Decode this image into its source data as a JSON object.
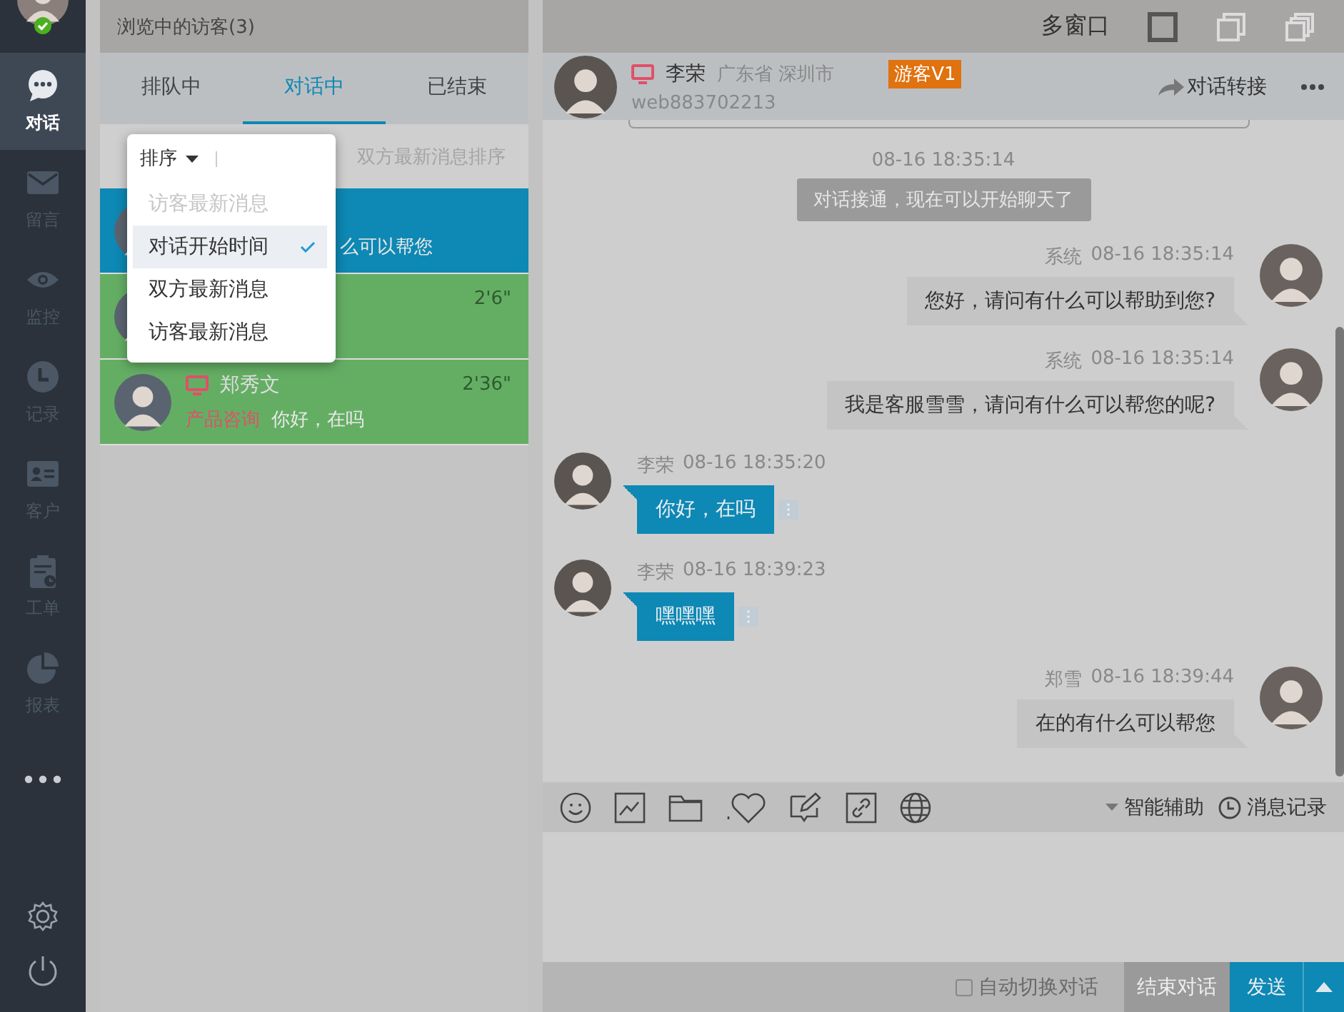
{
  "sidebar": {
    "items": [
      {
        "label": "对话",
        "selected": true
      },
      {
        "label": "留言",
        "selected": false
      },
      {
        "label": "监控",
        "selected": false
      },
      {
        "label": "记录",
        "selected": false
      },
      {
        "label": "客户",
        "selected": false
      },
      {
        "label": "工单",
        "selected": false
      },
      {
        "label": "报表",
        "selected": false
      }
    ]
  },
  "visitor_panel": {
    "title": "浏览中的访客(3)",
    "tabs": [
      {
        "label": "排队中",
        "selected": false
      },
      {
        "label": "对话中",
        "selected": true
      },
      {
        "label": "已结束",
        "selected": false
      }
    ],
    "sort_text": "双方最新消息排序",
    "sort_menu": {
      "label": "排序",
      "options": [
        {
          "label": "访客最新消息",
          "disabled": true,
          "selected": false
        },
        {
          "label": "对话开始时间",
          "disabled": false,
          "selected": true
        },
        {
          "label": "双方最新消息",
          "disabled": false,
          "selected": false
        },
        {
          "label": "访客最新消息",
          "disabled": false,
          "selected": false
        }
      ]
    },
    "visitors": [
      {
        "selected": true,
        "preview": "么可以帮您"
      },
      {
        "selected": false,
        "duration": "2'6\""
      },
      {
        "selected": false,
        "name": "郑秀文",
        "duration": "2'36\"",
        "tag": "产品咨询",
        "preview": "你好，在吗"
      }
    ]
  },
  "chat": {
    "window_bar": {
      "label": "多窗口",
      "layouts": [
        {
          "kind": "single",
          "selected": true
        },
        {
          "kind": "double",
          "selected": false
        },
        {
          "kind": "triple",
          "selected": false
        }
      ]
    },
    "visitor": {
      "name": "李荣",
      "location": "广东省 深圳市",
      "badge": "游客V1",
      "id": "web883702213"
    },
    "transfer": "对话转接",
    "messages": [
      {
        "kind": "time",
        "text": "08-16 18:35:14"
      },
      {
        "kind": "notice",
        "text": "对话接通，现在可以开始聊天了"
      },
      {
        "kind": "agent",
        "sender": "系统",
        "time": "08-16 18:35:14",
        "text": "您好，请问有什么可以帮助到您?"
      },
      {
        "kind": "agent",
        "sender": "系统",
        "time": "08-16 18:35:14",
        "text": "我是客服雪雪，请问有什么可以帮您的呢?"
      },
      {
        "kind": "visitor",
        "sender": "李荣",
        "time": "08-16 18:35:20",
        "text": "你好，在吗"
      },
      {
        "kind": "visitor",
        "sender": "李荣",
        "time": "08-16 18:39:23",
        "text": "嘿嘿嘿"
      },
      {
        "kind": "agent",
        "sender": "郑雪",
        "time": "08-16 18:39:44",
        "text": "在的有什么可以帮您"
      }
    ],
    "toolbar": {
      "assist": "智能辅助",
      "history": "消息记录"
    },
    "footer": {
      "auto_switch": {
        "label": "自动切换对话",
        "checked": false
      },
      "end_button": "结束对话",
      "send_button": "发送"
    }
  }
}
